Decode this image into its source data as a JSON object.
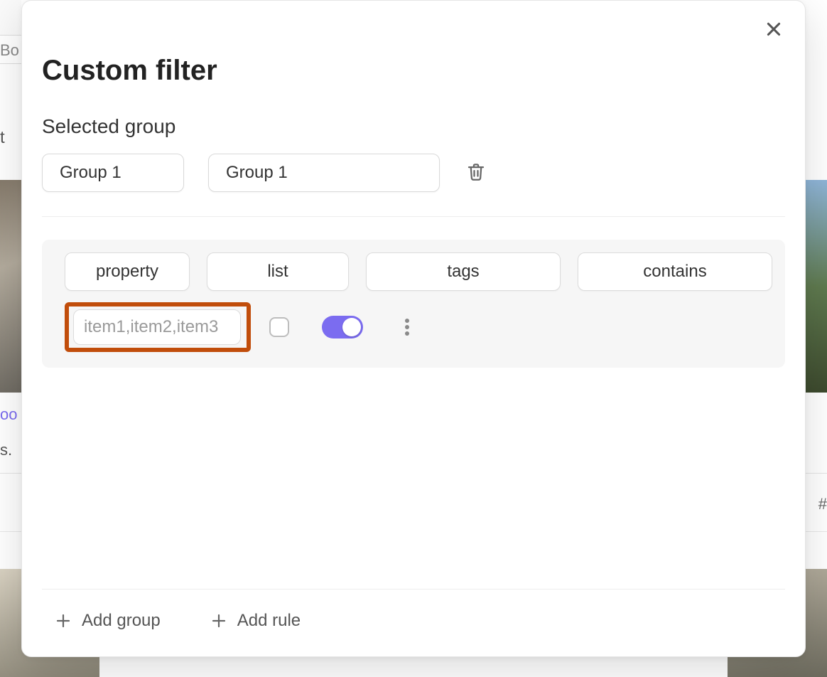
{
  "modal": {
    "title": "Custom filter",
    "selected_group_label": "Selected group",
    "group_buttons": [
      "Group 1",
      "Group 1"
    ]
  },
  "rule": {
    "chips": {
      "kind": "property",
      "type": "list",
      "field": "tags",
      "operator": "contains"
    },
    "value_placeholder": "item1,item2,item3",
    "toggle_on": true
  },
  "footer": {
    "add_group": "Add group",
    "add_rule": "Add rule"
  },
  "colors": {
    "accent": "#7b6cf0",
    "highlight": "#c14d0b"
  },
  "background_fragments": {
    "top_cut": "Bo",
    "left_char": "t",
    "link_cut": "oo",
    "s_cut": "s.",
    "hash": "#"
  }
}
